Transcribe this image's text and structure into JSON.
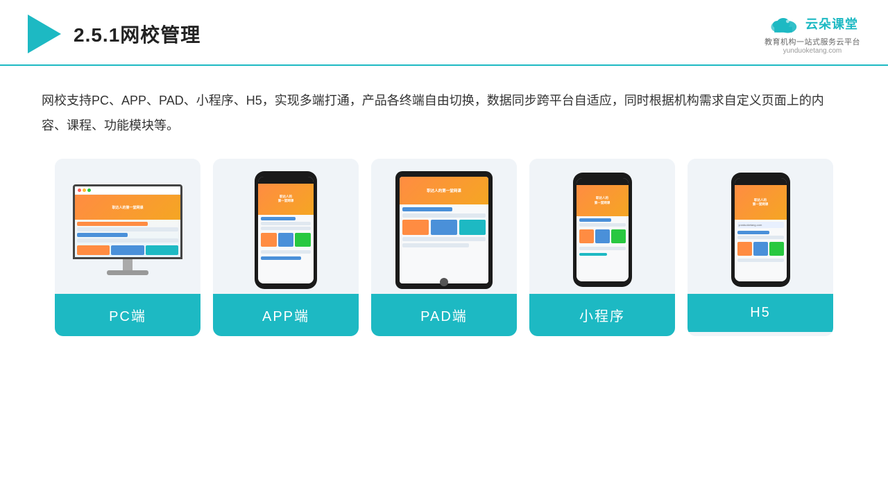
{
  "header": {
    "title": "2.5.1网校管理",
    "logo_main": "云朵课堂",
    "logo_sub": "yunduoketang.com",
    "logo_tagline": "教育机构一站式服务云平台"
  },
  "description": {
    "text": "网校支持PC、APP、PAD、小程序、H5，实现多端打通，产品各终端自由切换，数据同步跨平台自适应，同时根据机构需求自定义页面上的内容、课程、功能模块等。"
  },
  "cards": [
    {
      "id": "pc",
      "label": "PC端"
    },
    {
      "id": "app",
      "label": "APP端"
    },
    {
      "id": "pad",
      "label": "PAD端"
    },
    {
      "id": "miniprogram",
      "label": "小程序"
    },
    {
      "id": "h5",
      "label": "H5"
    }
  ],
  "colors": {
    "teal": "#1db9c3",
    "dark": "#1a1a1a",
    "bg_card": "#f0f4f8"
  }
}
